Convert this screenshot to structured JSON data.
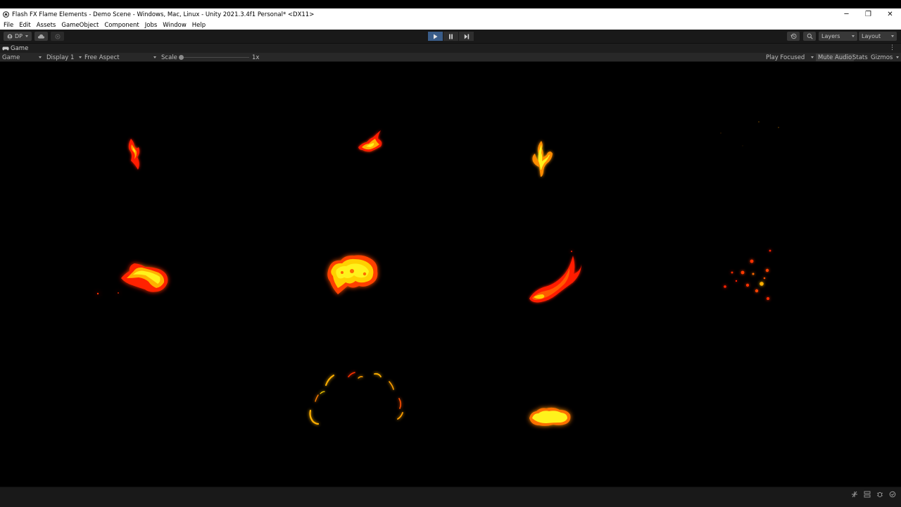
{
  "window": {
    "title": "Flash FX Flame Elements - Demo Scene - Windows, Mac, Linux - Unity 2021.3.4f1 Personal* <DX11>",
    "controls": {
      "minimize": "─",
      "restore": "❐",
      "close": "✕"
    }
  },
  "menu": {
    "items": [
      "File",
      "Edit",
      "Assets",
      "GameObject",
      "Component",
      "Jobs",
      "Window",
      "Help"
    ]
  },
  "toolbar": {
    "account_label": "DP",
    "layers_label": "Layers",
    "layout_label": "Layout",
    "play_state": "playing"
  },
  "tab": {
    "label": "Game"
  },
  "gamebar": {
    "mode": "Game",
    "display": "Display 1",
    "aspect": "Free Aspect",
    "scale_label": "Scale",
    "scale_value": "1x",
    "play_focused": "Play Focused",
    "mute_audio": "Mute Audio",
    "stats": "Stats",
    "gizmos": "Gizmos"
  },
  "colors": {
    "play_active": "#3a5d89",
    "flame_core": "#fff21a",
    "flame_mid": "#ffa000",
    "flame_edge": "#ff1a00"
  },
  "effects": [
    "flame-wisp",
    "flame-splash",
    "flame-sprout",
    "flame-sparks-faint",
    "flame-blob-left",
    "flame-burst",
    "flame-trail",
    "flame-embers",
    "flame-ring",
    "flame-puff"
  ]
}
